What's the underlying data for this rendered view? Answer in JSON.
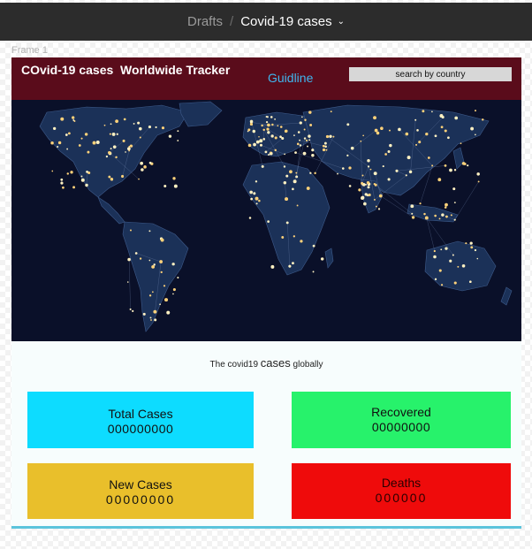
{
  "topbar": {
    "breadcrumb_parent": "Drafts",
    "breadcrumb_separator": "/",
    "breadcrumb_current": "Covid-19 cases",
    "chevron_icon": "chevron-down-icon"
  },
  "frame": {
    "label": "Frame 1"
  },
  "header": {
    "title": "COvid-19 cases  Worldwide Tracker",
    "guide_link": "Guidline",
    "search_value": "search by country",
    "bg_color": "#5a0c1b"
  },
  "map": {
    "image": "world-map-connections-night"
  },
  "caption": {
    "prefix": "The covid19 ",
    "emphasis": "cases",
    "suffix": " globally"
  },
  "cards": {
    "total": {
      "label": "Total Cases",
      "value": "000000000",
      "color": "#0ddcff"
    },
    "recovered": {
      "label": "Recovered",
      "value": "00000000",
      "color": "#27f26b"
    },
    "new_cases": {
      "label": "New Cases",
      "value": "00000000",
      "color": "#e9bf2b"
    },
    "deaths": {
      "label": "Deaths",
      "value": "000000",
      "color": "#ef0b0b"
    }
  }
}
